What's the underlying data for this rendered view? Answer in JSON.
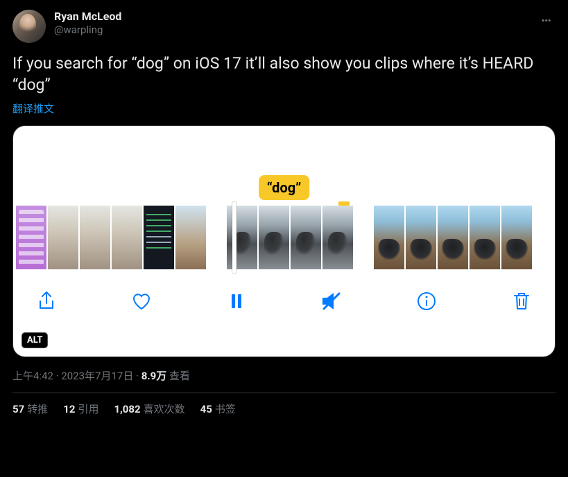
{
  "author": {
    "display_name": "Ryan McLeod",
    "handle": "@warpling"
  },
  "body": "If you search for “dog” on iOS 17 it’ll also show you clips where it’s HEARD “dog”",
  "translate_label": "翻译推文",
  "media": {
    "caption_bubble": "“dog”",
    "alt_badge": "ALT"
  },
  "meta": {
    "time": "上午4:42",
    "date": "2023年7月17日",
    "sep": " · ",
    "views_count": "8.9万",
    "views_label": " 查看"
  },
  "stats": {
    "retweets": {
      "n": "57",
      "label": "转推"
    },
    "quotes": {
      "n": "12",
      "label": "引用"
    },
    "likes": {
      "n": "1,082",
      "label": "喜欢次数"
    },
    "bookmarks": {
      "n": "45",
      "label": "书签"
    }
  }
}
